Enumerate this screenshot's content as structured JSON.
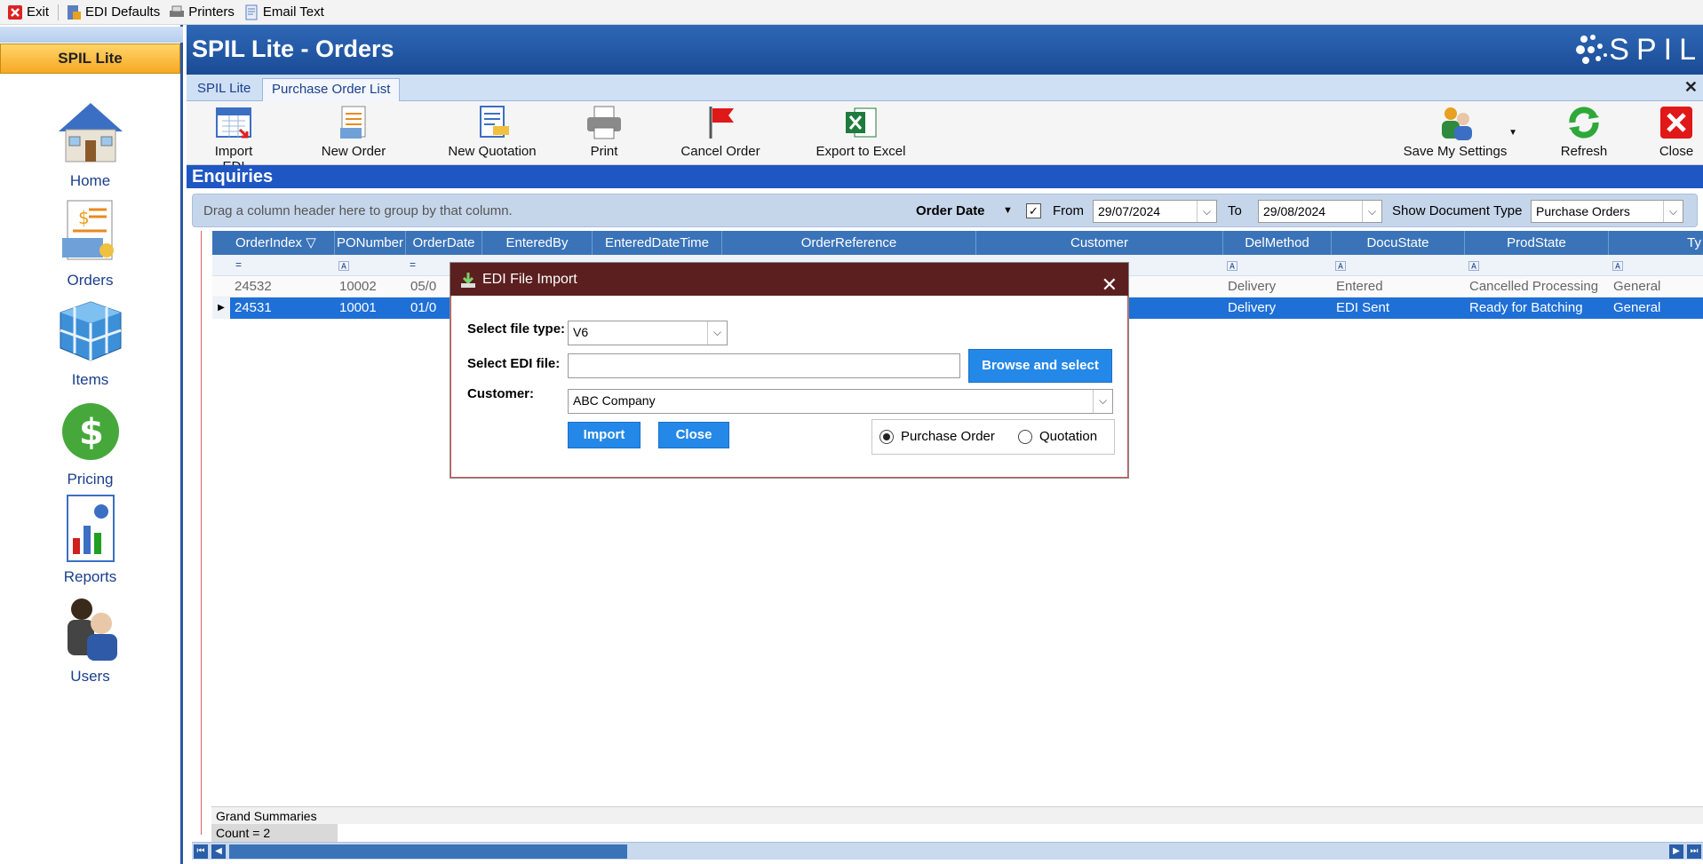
{
  "topbar": {
    "exit_label": "Exit",
    "edi_defaults_label": "EDI Defaults",
    "printers_label": "Printers",
    "email_text_label": "Email Text"
  },
  "sidebar": {
    "header": "SPIL Lite",
    "items": [
      {
        "label": "Home",
        "icon": "home-icon"
      },
      {
        "label": "Orders",
        "icon": "orders-icon"
      },
      {
        "label": "Items",
        "icon": "items-icon"
      },
      {
        "label": "Pricing",
        "icon": "pricing-icon"
      },
      {
        "label": "Reports",
        "icon": "reports-icon"
      },
      {
        "label": "Users",
        "icon": "users-icon"
      }
    ]
  },
  "titlebar": {
    "title": "SPIL Lite - Orders",
    "logo_text": "SPIL"
  },
  "tabs": [
    {
      "label": "SPIL Lite",
      "active": false
    },
    {
      "label": "Purchase Order List",
      "active": true
    }
  ],
  "ribbon": {
    "import_edi": "Import EDI",
    "new_order": "New Order",
    "new_quotation": "New Quotation",
    "print": "Print",
    "cancel_order": "Cancel Order",
    "export_excel": "Export to Excel",
    "save_settings": "Save My Settings",
    "refresh": "Refresh",
    "close": "Close"
  },
  "section_title": "Enquiries",
  "filterbar": {
    "group_hint": "Drag a column header here to group by that column.",
    "date_field": "Order Date",
    "from_label": "From",
    "from_value": "29/07/2024",
    "to_label": "To",
    "to_value": "29/08/2024",
    "doc_type_label": "Show Document Type",
    "doc_type_value": "Purchase Orders"
  },
  "grid": {
    "columns": [
      "OrderIndex",
      "PONumber",
      "OrderDate",
      "EnteredBy",
      "EnteredDateTime",
      "OrderReference",
      "Customer",
      "DelMethod",
      "DocuState",
      "ProdState",
      "Ty"
    ],
    "rows": [
      {
        "OrderIndex": "24532",
        "PONumber": "10002",
        "OrderDate": "05/0",
        "DelMethod": "Delivery",
        "DocuState": "Entered",
        "ProdState": "Cancelled Processing",
        "Type": "General",
        "selected": false
      },
      {
        "OrderIndex": "24531",
        "PONumber": "10001",
        "OrderDate": "01/0",
        "DelMethod": "Delivery",
        "DocuState": "EDI Sent",
        "ProdState": "Ready for Batching",
        "Type": "General",
        "selected": true
      }
    ],
    "summaries_label": "Grand Summaries",
    "count_label": "Count = 2"
  },
  "dialog": {
    "title": "EDI File Import",
    "file_type_label": "Select file type:",
    "file_type_value": "V6",
    "edi_file_label": "Select EDI file:",
    "edi_file_value": "",
    "browse_button": "Browse and select",
    "customer_label": "Customer:",
    "customer_value": "ABC Company",
    "import_button": "Import",
    "close_button": "Close",
    "radio_purchase_order": "Purchase Order",
    "radio_quotation": "Quotation",
    "selected_radio": "Purchase Order"
  },
  "colors": {
    "title_bar": "#1b4b95",
    "enquiries_bar": "#1e56c4",
    "grid_header": "#3a73b8",
    "selected_row": "#1e6fd6",
    "dialog_title": "#5b1f1f",
    "dialog_button": "#2488e8",
    "sidebar_header": "#f7a823"
  }
}
